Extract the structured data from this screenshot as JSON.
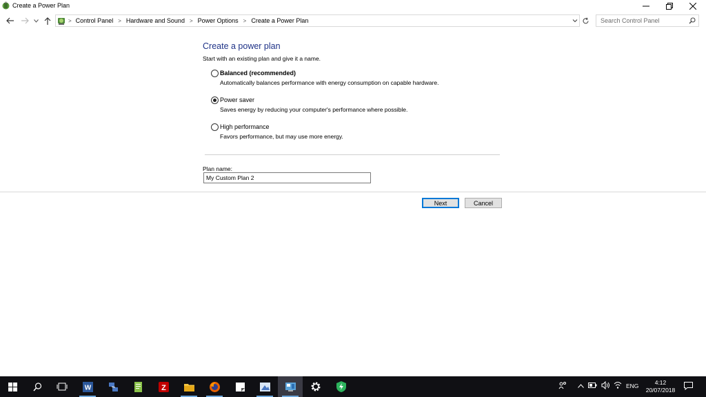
{
  "window": {
    "title": "Create a Power Plan"
  },
  "address": {
    "breadcrumbs": [
      "Control Panel",
      "Hardware and Sound",
      "Power Options",
      "Create a Power Plan"
    ],
    "search_placeholder": "Search Control Panel"
  },
  "content": {
    "heading": "Create a power plan",
    "subtext": "Start with an existing plan and give it a name.",
    "options": [
      {
        "label": "Balanced (recommended)",
        "description": "Automatically balances performance with energy consumption on capable hardware.",
        "checked": false
      },
      {
        "label": "Power saver",
        "description": "Saves energy by reducing your computer's performance where possible.",
        "checked": true
      },
      {
        "label": "High performance",
        "description": "Favors performance, but may use more energy.",
        "checked": false
      }
    ],
    "plan_name_label": "Plan name:",
    "plan_name_value": "My Custom Plan 2",
    "next_label": "Next",
    "cancel_label": "Cancel"
  },
  "taskbar": {
    "apps": [
      "start",
      "search",
      "task-view",
      "word",
      "network-app",
      "notepad-app",
      "filezilla",
      "file-explorer",
      "firefox",
      "sticky-app",
      "paint-app",
      "control-panel",
      "settings",
      "security-app"
    ],
    "language": "ENG",
    "time": "4:12",
    "date": "20/07/2018"
  },
  "colors": {
    "heading": "#1e3287",
    "taskbar": "#101014",
    "accent": "#0078d7"
  }
}
